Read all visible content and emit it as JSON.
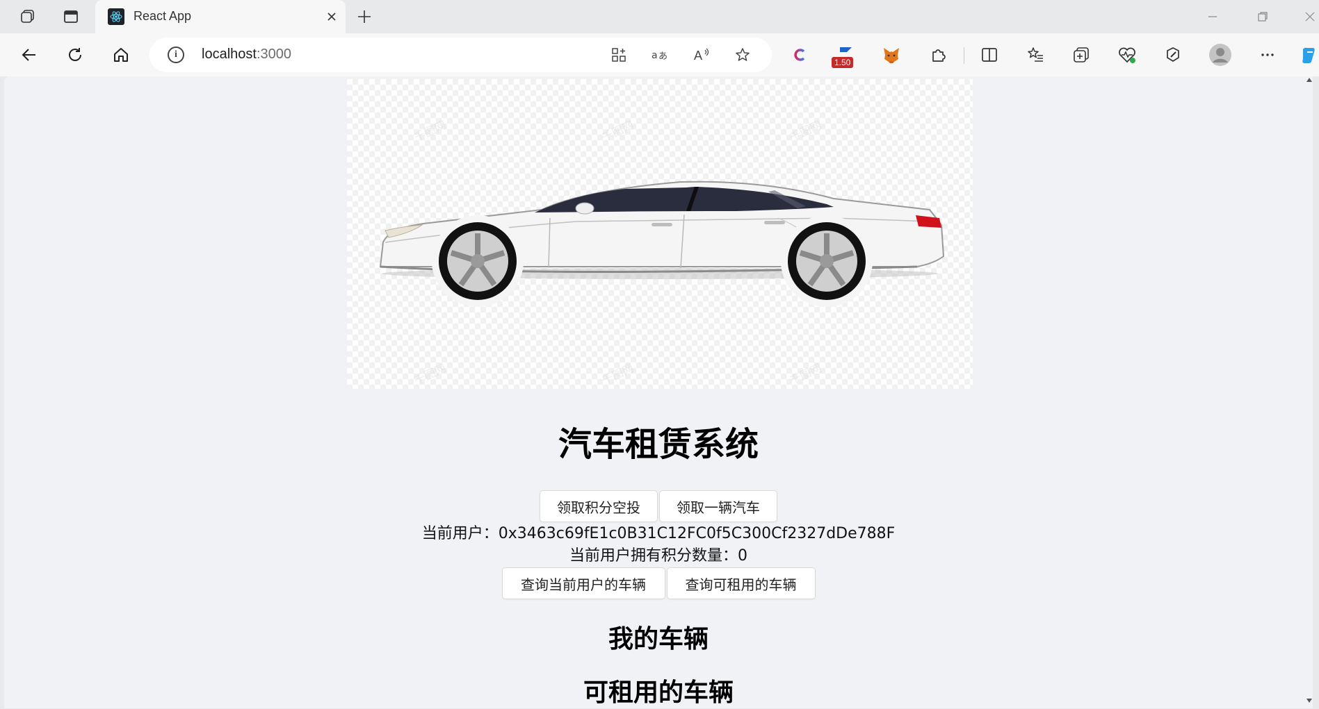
{
  "browser": {
    "tab_title": "React App",
    "url_host": "localhost",
    "url_port": ":3000",
    "extension_badge": "1.50"
  },
  "page": {
    "title": "汽车租赁系统",
    "buttons_top": {
      "airdrop": "领取积分空投",
      "claim_car": "领取一辆汽车"
    },
    "current_user_label": "当前用户：",
    "current_user_address": "0x3463c69fE1c0B31C12FC0f5C300Cf2327dDe788F",
    "points_label": "当前用户拥有积分数量：",
    "points_value": "0",
    "buttons_query": {
      "my_cars": "查询当前用户的车辆",
      "available_cars": "查询可租用的车辆"
    },
    "my_cars_heading": "我的车辆",
    "available_cars_heading": "可租用的车辆"
  },
  "colors": {
    "page_bg": "#f0f2f5",
    "chrome_bg": "#e8e9eb",
    "toolbar_bg": "#f7f7f7",
    "car_body": "#f4f4f4",
    "taillight": "#d0101a"
  },
  "icons": {
    "tab_actions": "tab-actions-icon",
    "vertical_tabs": "vertical-tabs-icon",
    "react_favicon": "react-icon",
    "back": "back-arrow-icon",
    "refresh": "refresh-icon",
    "home": "home-icon"
  }
}
